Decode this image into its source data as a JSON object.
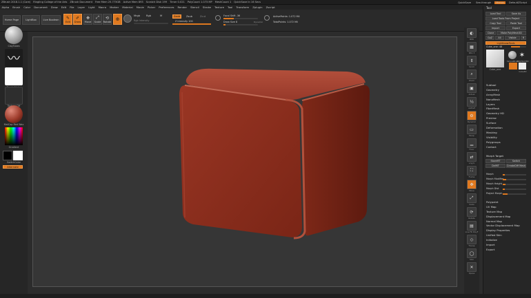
{
  "titlebar": {
    "items": [
      "ZBrush 2018.1.1 (Core)",
      "Ringling College of the Arts",
      "ZBrush Document",
      "Free Mem 25.773GB",
      "Active Mem 893",
      "Scratch Disk 199",
      "Timer 0.021",
      "PolyCount 1.073 MP",
      "MeshCount 1",
      "QuickSave In 16 Secs"
    ],
    "quicksave_label": "QuickSave",
    "seethrough_label": "See-through",
    "menus_label": "Menus",
    "defaultscript_label": "DefaultZScript"
  },
  "menubar": {
    "items": [
      "Alpha",
      "Brush",
      "Color",
      "Document",
      "Draw",
      "Edit",
      "File",
      "Layer",
      "Light",
      "Macro",
      "Marker",
      "Material",
      "Movie",
      "Picker",
      "Preferences",
      "Render",
      "Stencil",
      "Stroke",
      "Texture",
      "Tool",
      "Transform",
      "Zplugin",
      "Zscript"
    ],
    "coords": "-0.386,-0.575,-0.008"
  },
  "shelf": {
    "home_page": "Home Page",
    "lightbox": "LightBox",
    "live_boolean": "Live Boolean",
    "edit": "Edit",
    "draw": "Draw",
    "move": "Move",
    "scale": "Scale",
    "rotate": "Rotate",
    "mrgb": "Mrgb",
    "rgb": "Rgb",
    "m": "M",
    "rgb_intensity": "Rgb Intensity",
    "zadd": "Zadd",
    "zsub": "Zsub",
    "zcut": "Zcut",
    "z_intensity": "Z Intensity 100",
    "focal_shift": "Focal Shift -36",
    "draw_size": "Draw Size 8",
    "dynamic": "Dynamic",
    "active_points": "ActivePoints: 1.072 Mil",
    "total_points": "TotalPoints: 1.072 Mil"
  },
  "lefttray": {
    "brush": "ClayTubes",
    "stroke": "FreeHand",
    "alpha": "Brush Alpha",
    "texture": "Texture Off",
    "material": "MatCap Red Wax",
    "gradient": "Gradient",
    "switch_color": "SwitchColor",
    "alternate": "Alternate"
  },
  "righttool": {
    "labels": [
      "BPR",
      "SPix 3",
      "Scroll",
      "Zoom",
      "Actual",
      "AAHalf",
      "Dynamic",
      "Persp",
      "Floor",
      "L.Sym",
      "Frame",
      "Move",
      "Scale",
      "Rotate",
      "Line Fill PolyF",
      "Transp",
      "Solo",
      "Xpose"
    ]
  },
  "panel": {
    "title": "Tool",
    "load_tool": "Load Tool",
    "save_as": "Save As",
    "load_tools_project": "Load Tools From Project",
    "copy_tool": "Copy Tool",
    "paste_tool": "Paste Tool",
    "import": "Import",
    "export": "Export",
    "clone": "Clone",
    "make_polymesh": "Make PolyMesh3D",
    "goz": "GoZ",
    "all": "All",
    "visible": "Visible",
    "r": "R",
    "lightbox_tools": "Lightbox▸Tools",
    "cube_label": "Cube_one",
    "color_pos": "Cube_one: 48",
    "thumbs": [
      "Cube_one",
      "SimpleBrush",
      "PolyMesh3D",
      "Cube3D"
    ],
    "menu_items_top": [
      "Subtool",
      "Geometry",
      "ArrayMesh",
      "NanoMesh",
      "Layers",
      "FiberMesh",
      "Geometry HD",
      "Preview",
      "Surface",
      "Deformation",
      "Masking",
      "Visibility",
      "Polygroups",
      "Contact"
    ],
    "morph_target": "Morph Target",
    "store_mt": "StoreMT",
    "switch": "Switch",
    "del_mt": "DelMT",
    "create_diff_mesh": "CreateDiff Mesh",
    "morph_sliders": [
      {
        "label": "Morph",
        "fill": 0.1
      },
      {
        "label": "Morph Modifier",
        "fill": 0.15
      },
      {
        "label": "Morph Height",
        "fill": 0.12
      },
      {
        "label": "Morph Dist",
        "fill": 0.08
      },
      {
        "label": "Project Morph",
        "fill": 0.2
      }
    ],
    "menu_items_bottom": [
      "Polypaint",
      "UV Map",
      "Texture Map",
      "Displacement Map",
      "Normal Map",
      "Vector Displacement Map",
      "Display Properties",
      "Unified Skin",
      "Initialize",
      "Import",
      "Export"
    ]
  },
  "colors": {
    "accent": "#e0791f",
    "cube_face": "#8e2e1e",
    "viewport": "#363636"
  }
}
